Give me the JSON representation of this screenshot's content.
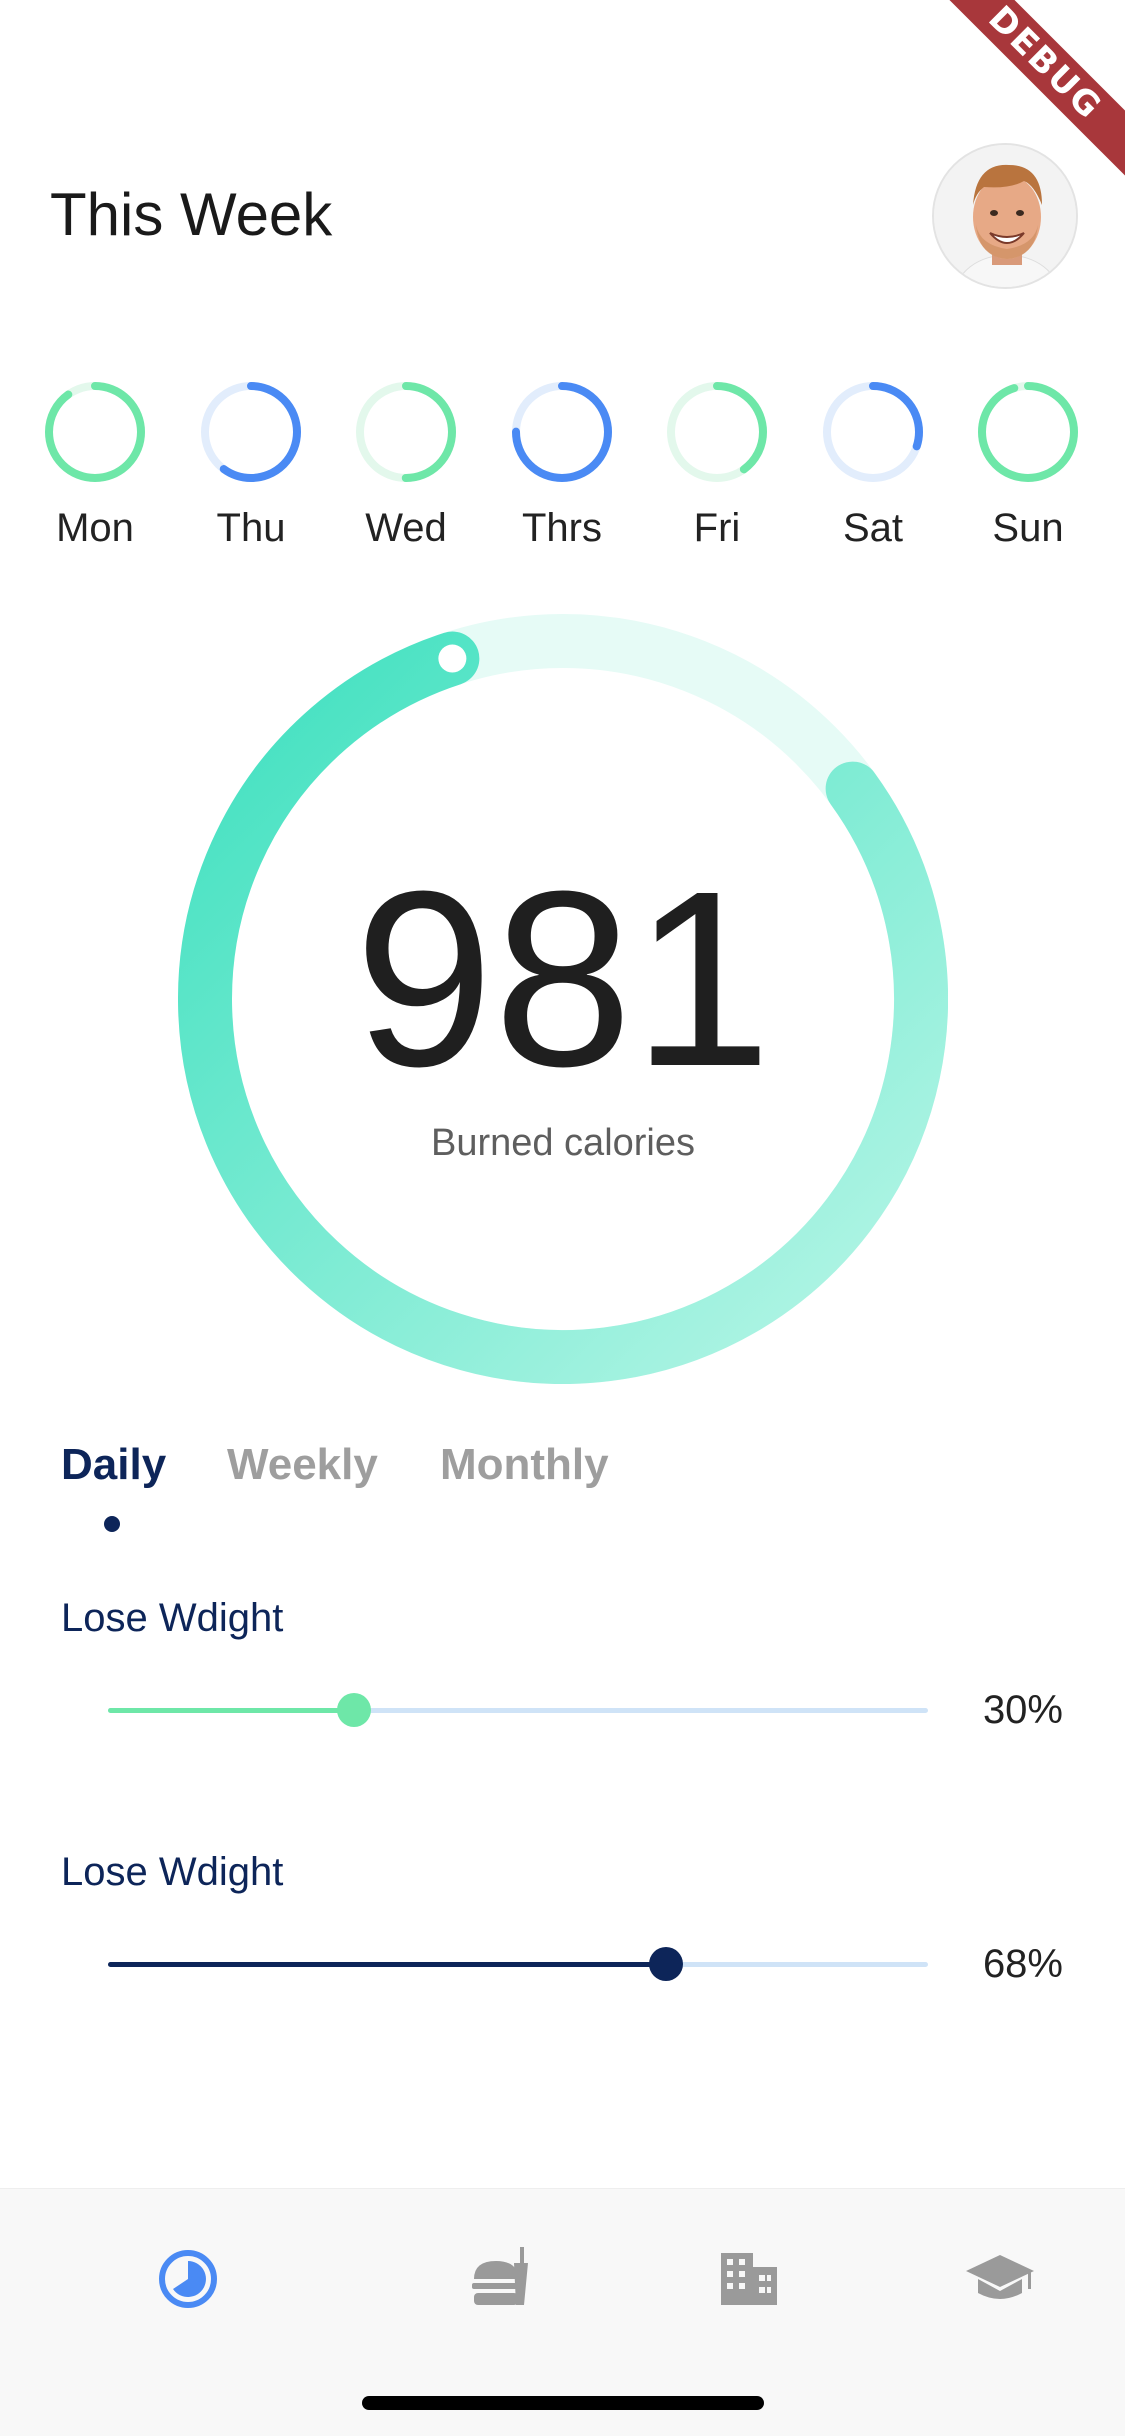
{
  "debug_banner": {
    "label": "DEBUG"
  },
  "header": {
    "title": "This Week"
  },
  "week": {
    "days": [
      {
        "label": "Mon",
        "progress": 0.9,
        "color": "#6ee7a8",
        "track": "#e3f8ec"
      },
      {
        "label": "Thu",
        "progress": 0.6,
        "color": "#4a8af4",
        "track": "#e2edfc"
      },
      {
        "label": "Wed",
        "progress": 0.5,
        "color": "#6ee7a8",
        "track": "#e3f8ec"
      },
      {
        "label": "Thrs",
        "progress": 0.75,
        "color": "#4a8af4",
        "track": "#e2edfc"
      },
      {
        "label": "Fri",
        "progress": 0.4,
        "color": "#6ee7a8",
        "track": "#e3f8ec"
      },
      {
        "label": "Sat",
        "progress": 0.3,
        "color": "#4a8af4",
        "track": "#e2edfc"
      },
      {
        "label": "Sun",
        "progress": 0.95,
        "color": "#6ee7a8",
        "track": "#e3f8ec"
      }
    ]
  },
  "calories": {
    "value": "981",
    "caption": "Burned calories",
    "progress": 0.8,
    "color_start": "#3ee0bf",
    "color_end": "#b9f6e7",
    "track_color": "#e6fbf6"
  },
  "tabs": {
    "items": [
      {
        "label": "Daily",
        "active": true
      },
      {
        "label": "Weekly",
        "active": false
      },
      {
        "label": "Monthly",
        "active": false
      }
    ]
  },
  "goals": [
    {
      "label": "Lose Wdight",
      "value_text": "30%",
      "value": 0.3,
      "color": "#6ee7a8"
    },
    {
      "label": "Lose Wdight",
      "value_text": "68%",
      "value": 0.68,
      "color": "#0d2559"
    }
  ],
  "nav": {
    "items": [
      {
        "icon": "pie-chart-icon",
        "active": true
      },
      {
        "icon": "fastfood-icon",
        "active": false
      },
      {
        "icon": "building-icon",
        "active": false
      },
      {
        "icon": "graduation-cap-icon",
        "active": false
      }
    ],
    "active_color": "#4a8af4",
    "inactive_color": "#9a9a9a"
  }
}
